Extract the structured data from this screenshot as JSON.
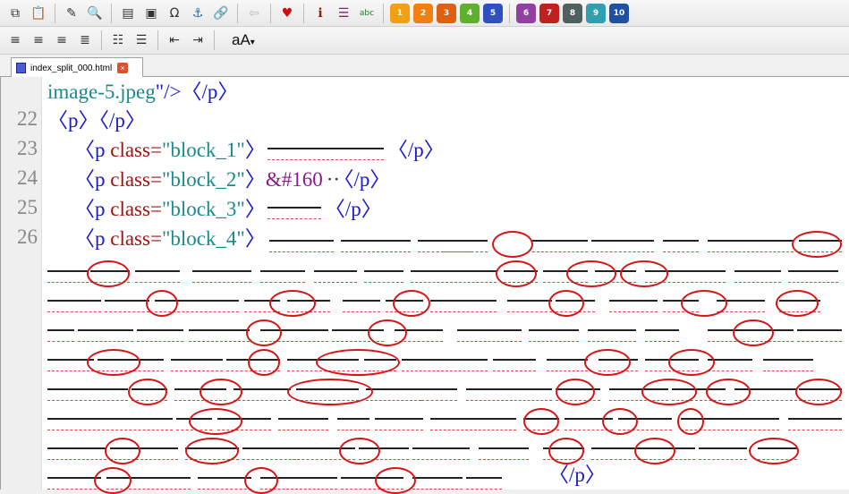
{
  "toolbar_row1": {
    "icons": [
      "copy-icon",
      "paste-icon",
      "edit-icon",
      "find-icon",
      "split-icon",
      "image-icon",
      "omega-icon",
      "anchor-icon",
      "link-icon",
      "back-icon",
      "heart-icon",
      "metadata-icon",
      "toc-icon",
      "spellcheck-icon"
    ],
    "heading_labels": [
      "1",
      "2",
      "3",
      "4",
      "5",
      "6",
      "7",
      "8",
      "9",
      "10"
    ],
    "heading_colors": [
      "#f0a010",
      "#f08010",
      "#e06010",
      "#60b030",
      "#3050c0",
      "#9040a0",
      "#c02020",
      "#506060",
      "#30a0b0",
      "#2050a0"
    ],
    "omega": "Ω"
  },
  "toolbar_row2": {
    "case_label": "aA"
  },
  "tab": {
    "filename": "index_split_000.html",
    "close": "×"
  },
  "editor": {
    "line_numbers": [
      "22",
      "23",
      "24",
      "25",
      "26"
    ],
    "line0_value": "image-5.jpeg",
    "line0_tail": "\"/>〈/p〉",
    "line22": "〈p〉〈/p〉",
    "line23_open": "〈p ",
    "line23_attr": "class=",
    "line23_val": "\"block_1\"",
    "line23_close": "〉",
    "line23_end": "〈/p〉",
    "line24_val": "\"block_2\"",
    "line24_ent": "&#160",
    "line24_end": "〈/p〉",
    "line25_val": "\"block_3\"",
    "line25_end": "〈/p〉",
    "line26_val": "\"block_4\"",
    "line26_end": "〈/p〉"
  }
}
